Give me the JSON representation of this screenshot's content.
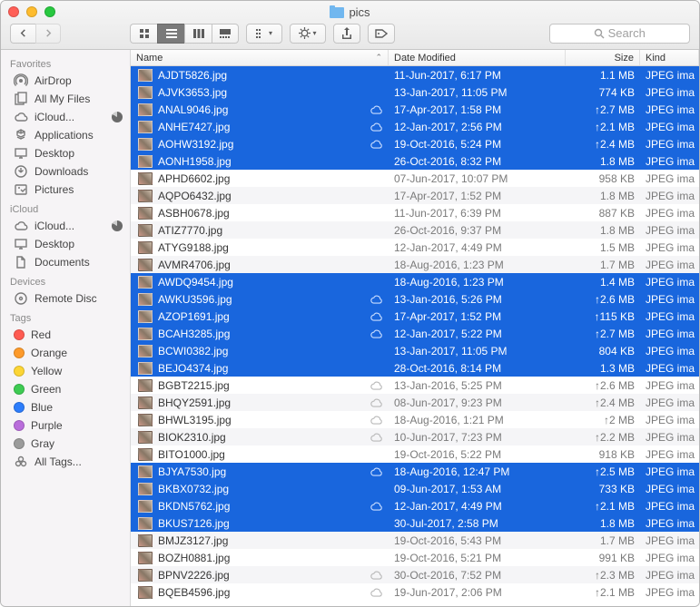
{
  "window": {
    "title": "pics"
  },
  "search": {
    "placeholder": "Search"
  },
  "columns": {
    "name": "Name",
    "date": "Date Modified",
    "size": "Size",
    "kind": "Kind"
  },
  "sidebar": {
    "sections": [
      {
        "header": "Favorites",
        "items": [
          {
            "label": "AirDrop",
            "icon": "airdrop"
          },
          {
            "label": "All My Files",
            "icon": "allfiles"
          },
          {
            "label": "iCloud...",
            "icon": "cloud",
            "pie": true
          },
          {
            "label": "Applications",
            "icon": "apps"
          },
          {
            "label": "Desktop",
            "icon": "desktop"
          },
          {
            "label": "Downloads",
            "icon": "downloads"
          },
          {
            "label": "Pictures",
            "icon": "pictures"
          }
        ]
      },
      {
        "header": "iCloud",
        "items": [
          {
            "label": "iCloud...",
            "icon": "cloud",
            "pie": true
          },
          {
            "label": "Desktop",
            "icon": "desktop"
          },
          {
            "label": "Documents",
            "icon": "documents"
          }
        ]
      },
      {
        "header": "Devices",
        "items": [
          {
            "label": "Remote Disc",
            "icon": "disc"
          }
        ]
      },
      {
        "header": "Tags",
        "items": [
          {
            "label": "Red",
            "tag": "#ff5b52"
          },
          {
            "label": "Orange",
            "tag": "#fd9a2b"
          },
          {
            "label": "Yellow",
            "tag": "#fcd535"
          },
          {
            "label": "Green",
            "tag": "#3ecb53"
          },
          {
            "label": "Blue",
            "tag": "#2d7dfb"
          },
          {
            "label": "Purple",
            "tag": "#b96ddb"
          },
          {
            "label": "Gray",
            "tag": "#9b9b9b"
          },
          {
            "label": "All Tags...",
            "icon": "alltags"
          }
        ]
      }
    ]
  },
  "files": [
    {
      "name": "AJDT5826.jpg",
      "date": "11-Jun-2017, 6:17 PM",
      "size": "1.1 MB",
      "kind": "JPEG ima",
      "sel": true,
      "cloud": false,
      "up": false
    },
    {
      "name": "AJVK3653.jpg",
      "date": "13-Jan-2017, 11:05 PM",
      "size": "774 KB",
      "kind": "JPEG ima",
      "sel": true,
      "cloud": false,
      "up": false
    },
    {
      "name": "ANAL9046.jpg",
      "date": "17-Apr-2017, 1:58 PM",
      "size": "2.7 MB",
      "kind": "JPEG ima",
      "sel": true,
      "cloud": true,
      "up": true
    },
    {
      "name": "ANHE7427.jpg",
      "date": "12-Jan-2017, 2:56 PM",
      "size": "2.1 MB",
      "kind": "JPEG ima",
      "sel": true,
      "cloud": true,
      "up": true
    },
    {
      "name": "AOHW3192.jpg",
      "date": "19-Oct-2016, 5:24 PM",
      "size": "2.4 MB",
      "kind": "JPEG ima",
      "sel": true,
      "cloud": true,
      "up": true
    },
    {
      "name": "AONH1958.jpg",
      "date": "26-Oct-2016, 8:32 PM",
      "size": "1.8 MB",
      "kind": "JPEG ima",
      "sel": true,
      "cloud": false,
      "up": false
    },
    {
      "name": "APHD6602.jpg",
      "date": "07-Jun-2017, 10:07 PM",
      "size": "958 KB",
      "kind": "JPEG ima",
      "sel": false,
      "cloud": false,
      "up": false
    },
    {
      "name": "AQPO6432.jpg",
      "date": "17-Apr-2017, 1:52 PM",
      "size": "1.8 MB",
      "kind": "JPEG ima",
      "sel": false,
      "cloud": false,
      "up": false
    },
    {
      "name": "ASBH0678.jpg",
      "date": "11-Jun-2017, 6:39 PM",
      "size": "887 KB",
      "kind": "JPEG ima",
      "sel": false,
      "cloud": false,
      "up": false
    },
    {
      "name": "ATIZ7770.jpg",
      "date": "26-Oct-2016, 9:37 PM",
      "size": "1.8 MB",
      "kind": "JPEG ima",
      "sel": false,
      "cloud": false,
      "up": false
    },
    {
      "name": "ATYG9188.jpg",
      "date": "12-Jan-2017, 4:49 PM",
      "size": "1.5 MB",
      "kind": "JPEG ima",
      "sel": false,
      "cloud": false,
      "up": false
    },
    {
      "name": "AVMR4706.jpg",
      "date": "18-Aug-2016, 1:23 PM",
      "size": "1.7 MB",
      "kind": "JPEG ima",
      "sel": false,
      "cloud": false,
      "up": false
    },
    {
      "name": "AWDQ9454.jpg",
      "date": "18-Aug-2016, 1:23 PM",
      "size": "1.4 MB",
      "kind": "JPEG ima",
      "sel": true,
      "cloud": false,
      "up": false
    },
    {
      "name": "AWKU3596.jpg",
      "date": "13-Jan-2016, 5:26 PM",
      "size": "2.6 MB",
      "kind": "JPEG ima",
      "sel": true,
      "cloud": true,
      "up": true
    },
    {
      "name": "AZOP1691.jpg",
      "date": "17-Apr-2017, 1:52 PM",
      "size": "115 KB",
      "kind": "JPEG ima",
      "sel": true,
      "cloud": true,
      "up": true
    },
    {
      "name": "BCAH3285.jpg",
      "date": "12-Jan-2017, 5:22 PM",
      "size": "2.7 MB",
      "kind": "JPEG ima",
      "sel": true,
      "cloud": true,
      "up": true
    },
    {
      "name": "BCWI0382.jpg",
      "date": "13-Jan-2017, 11:05 PM",
      "size": "804 KB",
      "kind": "JPEG ima",
      "sel": true,
      "cloud": false,
      "up": false
    },
    {
      "name": "BEJO4374.jpg",
      "date": "28-Oct-2016, 8:14 PM",
      "size": "1.3 MB",
      "kind": "JPEG ima",
      "sel": true,
      "cloud": false,
      "up": false
    },
    {
      "name": "BGBT2215.jpg",
      "date": "13-Jan-2016, 5:25 PM",
      "size": "2.6 MB",
      "kind": "JPEG ima",
      "sel": false,
      "cloud": true,
      "up": true
    },
    {
      "name": "BHQY2591.jpg",
      "date": "08-Jun-2017, 9:23 PM",
      "size": "2.4 MB",
      "kind": "JPEG ima",
      "sel": false,
      "cloud": true,
      "up": true
    },
    {
      "name": "BHWL3195.jpg",
      "date": "18-Aug-2016, 1:21 PM",
      "size": "2 MB",
      "kind": "JPEG ima",
      "sel": false,
      "cloud": true,
      "up": true
    },
    {
      "name": "BIOK2310.jpg",
      "date": "10-Jun-2017, 7:23 PM",
      "size": "2.2 MB",
      "kind": "JPEG ima",
      "sel": false,
      "cloud": true,
      "up": true
    },
    {
      "name": "BITO1000.jpg",
      "date": "19-Oct-2016, 5:22 PM",
      "size": "918 KB",
      "kind": "JPEG ima",
      "sel": false,
      "cloud": false,
      "up": false
    },
    {
      "name": "BJYA7530.jpg",
      "date": "18-Aug-2016, 12:47 PM",
      "size": "2.5 MB",
      "kind": "JPEG ima",
      "sel": true,
      "cloud": true,
      "up": true
    },
    {
      "name": "BKBX0732.jpg",
      "date": "09-Jun-2017, 1:53 AM",
      "size": "733 KB",
      "kind": "JPEG ima",
      "sel": true,
      "cloud": false,
      "up": false
    },
    {
      "name": "BKDN5762.jpg",
      "date": "12-Jan-2017, 4:49 PM",
      "size": "2.1 MB",
      "kind": "JPEG ima",
      "sel": true,
      "cloud": true,
      "up": true
    },
    {
      "name": "BKUS7126.jpg",
      "date": "30-Jul-2017, 2:58 PM",
      "size": "1.8 MB",
      "kind": "JPEG ima",
      "sel": true,
      "cloud": false,
      "up": false
    },
    {
      "name": "BMJZ3127.jpg",
      "date": "19-Oct-2016, 5:43 PM",
      "size": "1.7 MB",
      "kind": "JPEG ima",
      "sel": false,
      "cloud": false,
      "up": false
    },
    {
      "name": "BOZH0881.jpg",
      "date": "19-Oct-2016, 5:21 PM",
      "size": "991 KB",
      "kind": "JPEG ima",
      "sel": false,
      "cloud": false,
      "up": false
    },
    {
      "name": "BPNV2226.jpg",
      "date": "30-Oct-2016, 7:52 PM",
      "size": "2.3 MB",
      "kind": "JPEG ima",
      "sel": false,
      "cloud": true,
      "up": true
    },
    {
      "name": "BQEB4596.jpg",
      "date": "19-Jun-2017, 2:06 PM",
      "size": "2.1 MB",
      "kind": "JPEG ima",
      "sel": false,
      "cloud": true,
      "up": true
    }
  ]
}
